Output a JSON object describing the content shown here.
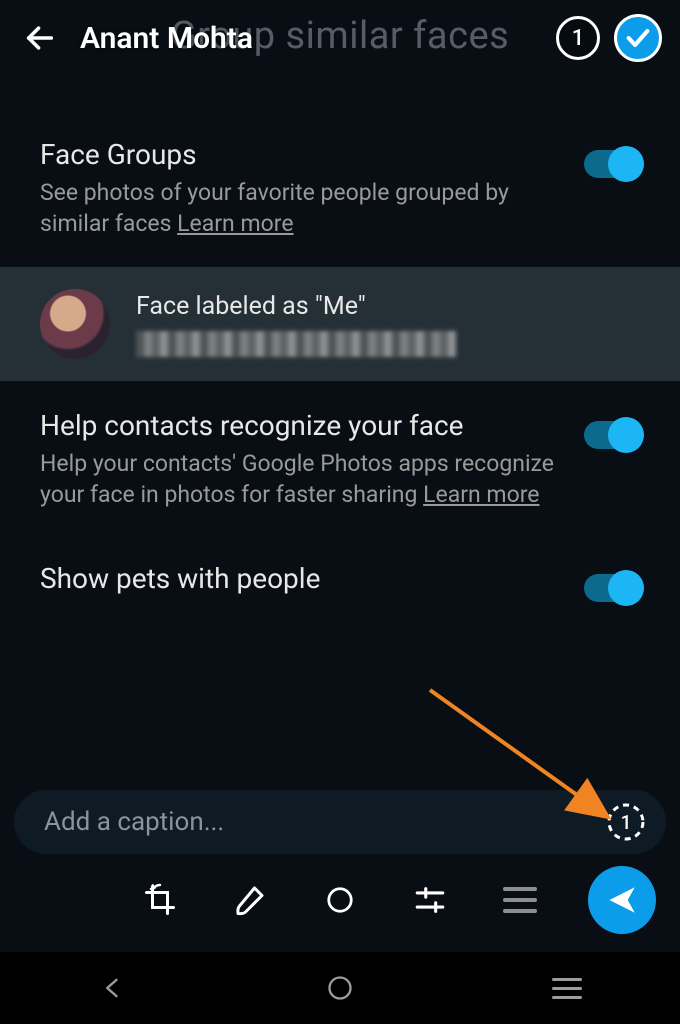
{
  "header": {
    "contact_name": "Anant Mohta",
    "selection_count": "1"
  },
  "ghost_title": "Group similar faces",
  "settings": {
    "face_groups": {
      "title": "Face Groups",
      "desc_a": "See photos of your favorite people grouped by similar faces ",
      "learn": "Learn more",
      "toggle_on": true
    },
    "me_card": {
      "label": "Face labeled as \"Me\""
    },
    "help_contacts": {
      "title": "Help contacts recognize your face",
      "desc_a": "Help your contacts' Google Photos apps recognize your face in photos for faster sharing ",
      "learn": "Learn more",
      "toggle_on": true
    },
    "pets": {
      "title": "Show pets with people",
      "toggle_on": true
    }
  },
  "caption": {
    "placeholder": "Add a caption...",
    "view_once_count": "1"
  },
  "colors": {
    "accent": "#0c9dea",
    "toggle": "#1cb6f5",
    "arrow": "#f08423"
  }
}
